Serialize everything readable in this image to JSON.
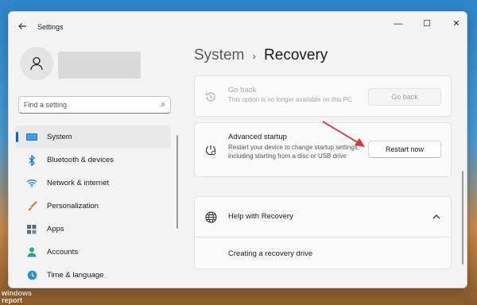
{
  "window": {
    "title": "Settings",
    "controls": [
      "—",
      "☐",
      "✕"
    ]
  },
  "search": {
    "placeholder": "Find a setting"
  },
  "sidebar": {
    "items": [
      {
        "label": "System",
        "icon": "system-icon",
        "active": true
      },
      {
        "label": "Bluetooth & devices",
        "icon": "bluetooth-icon"
      },
      {
        "label": "Network & internet",
        "icon": "wifi-icon"
      },
      {
        "label": "Personalization",
        "icon": "brush-icon"
      },
      {
        "label": "Apps",
        "icon": "apps-icon"
      },
      {
        "label": "Accounts",
        "icon": "accounts-icon"
      },
      {
        "label": "Time & language",
        "icon": "globe-clock-icon"
      }
    ]
  },
  "breadcrumb": {
    "root": "System",
    "separator": "›",
    "current": "Recovery"
  },
  "recovery": {
    "go_back": {
      "title": "Go back",
      "description": "This option is no longer available on this PC",
      "button": "Go back",
      "enabled": false
    },
    "advanced_startup": {
      "title": "Advanced startup",
      "description": "Restart your device to change startup settings, including starting from a disc or USB drive",
      "button": "Restart now"
    },
    "help": {
      "title": "Help with Recovery",
      "items": [
        "Creating a recovery drive"
      ],
      "expanded": true
    }
  },
  "watermark": {
    "line1": "windows",
    "line2": "report"
  },
  "colors": {
    "accent": "#0067c0",
    "arrow": "#e03131"
  }
}
